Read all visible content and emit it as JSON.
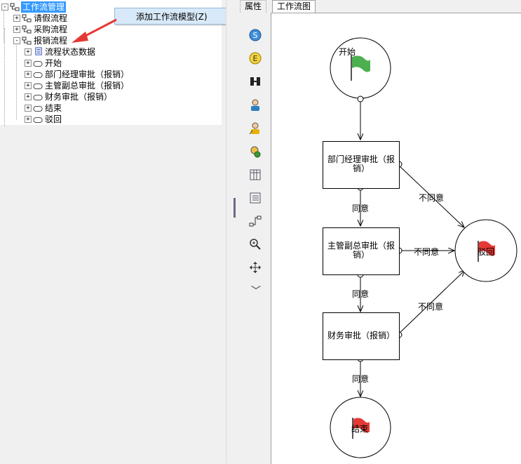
{
  "tree": {
    "root_label": "工作流管理",
    "items": [
      {
        "label": "请假流程",
        "expander": "+"
      },
      {
        "label": "采购流程",
        "expander": "+"
      },
      {
        "label": "报销流程",
        "expander": "-"
      }
    ],
    "children": [
      {
        "label": "流程状态数据",
        "expander": "+"
      },
      {
        "label": "开始",
        "expander": "+"
      },
      {
        "label": "部门经理审批（报销）",
        "expander": "+"
      },
      {
        "label": "主管副总审批（报销）",
        "expander": "+"
      },
      {
        "label": "财务审批（报销）",
        "expander": "+"
      },
      {
        "label": "结束",
        "expander": "+"
      },
      {
        "label": "驳回",
        "expander": "+"
      }
    ]
  },
  "context_menu": {
    "item_label": "添加工作流模型(Z)"
  },
  "tabs": [
    {
      "label": "属性"
    },
    {
      "label": "工作流图"
    }
  ],
  "toolbox": {
    "tools": [
      "start-event-icon",
      "end-event-icon",
      "fork-join-icon",
      "user-task-icon",
      "assign-task-icon",
      "decision-icon",
      "grid-icon",
      "list-icon",
      "connector-icon",
      "zoom-icon",
      "move-icon",
      "chevron-down-icon"
    ],
    "start_letter": "S",
    "end_letter": "E",
    "chevron": "﹀"
  },
  "diagram": {
    "start_label": "开始",
    "end_label": "结束",
    "reject_label": "驳回",
    "task1": "部门经理审批（报销）",
    "task2": "主管副总审批（报销）",
    "task3": "财务审批（报销）",
    "agree": "同意",
    "disagree": "不同意",
    "colors": {
      "start_flag": "#4caf50",
      "end_flag": "#e53935",
      "reject_flag": "#e53935"
    }
  }
}
